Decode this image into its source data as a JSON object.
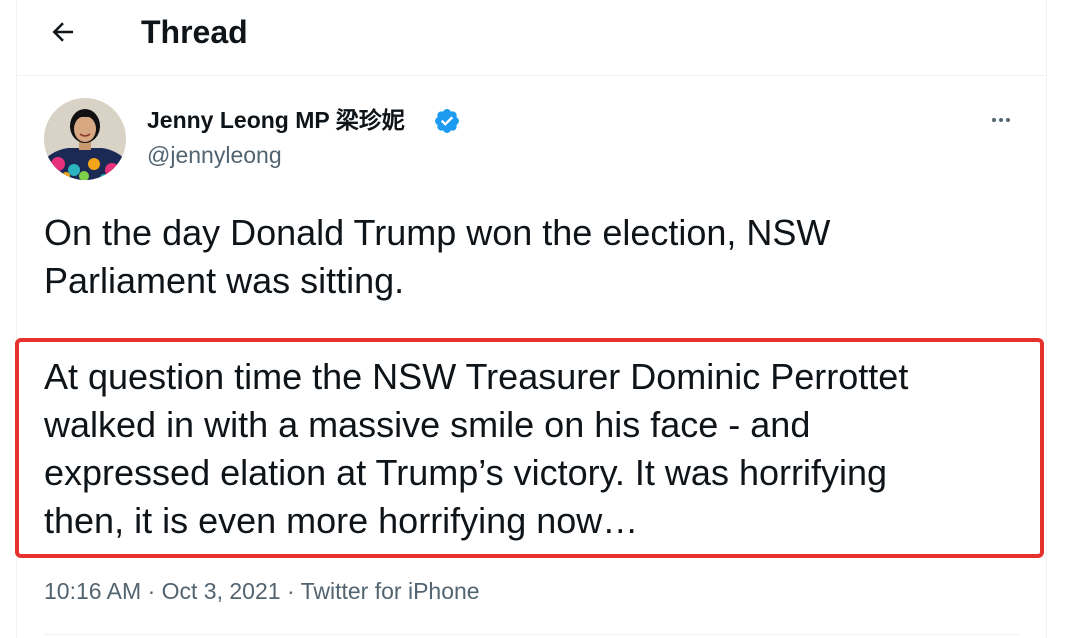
{
  "header": {
    "title": "Thread",
    "back_icon": "arrow-left-icon"
  },
  "tweet": {
    "author": {
      "display_name": "Jenny Leong MP 梁珍妮",
      "handle": "@jennyleong",
      "verified": true,
      "verified_color": "#1d9bf0"
    },
    "paragraphs": [
      "On the day Donald Trump won the election, NSW\nParliament was sitting.",
      "At question time the NSW Treasurer Dominic Perrottet\nwalked in with a massive smile on his face - and\nexpressed elation at Trump’s victory. It was horrifying\nthen, it is even more horrifying now…"
    ],
    "meta": {
      "time": "10:16 AM",
      "separator": "·",
      "date": "Oct 3, 2021",
      "source": "Twitter for iPhone"
    }
  },
  "annotation": {
    "highlight_color": "#e5322d"
  }
}
